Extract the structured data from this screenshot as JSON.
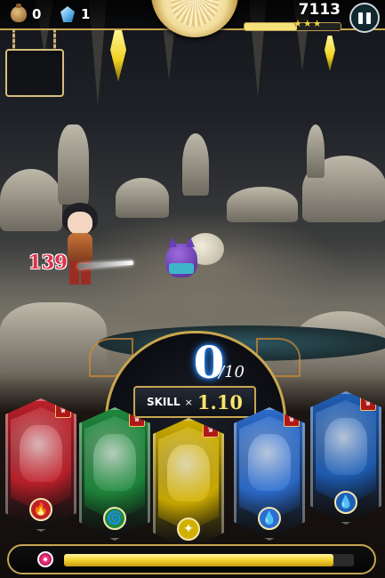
{
  "hud": {
    "coins": "0",
    "gems": "1",
    "score": "7113",
    "stars": "★★★",
    "stage_progress": 0.55
  },
  "battle": {
    "damage": "139"
  },
  "combo": {
    "current": "0",
    "max": "/10"
  },
  "skill": {
    "label": "SKILL",
    "multiplier_symbol": "×",
    "value": "1.10"
  },
  "party": [
    {
      "name": "Crimson warrior",
      "element": "fire",
      "color": "#c0202a",
      "icon": "🔥"
    },
    {
      "name": "Green hat mage",
      "element": "wind",
      "color": "#1e8a3c",
      "icon": "🌀"
    },
    {
      "name": "Golden dragon",
      "element": "light",
      "color": "#d2b000",
      "icon": "✦"
    },
    {
      "name": "Blue armored beast",
      "element": "water",
      "color": "#2c6dd0",
      "icon": "💧"
    },
    {
      "name": "Blue dragon",
      "element": "water",
      "color": "#1f5fb8",
      "icon": "💧"
    }
  ],
  "player": {
    "hp_fraction": 0.93
  },
  "icons": {
    "coin": "money-bag-icon",
    "gem": "crystal-icon",
    "pause": "pause-icon",
    "heart": "heart-icon",
    "badge": "crown-icon"
  }
}
